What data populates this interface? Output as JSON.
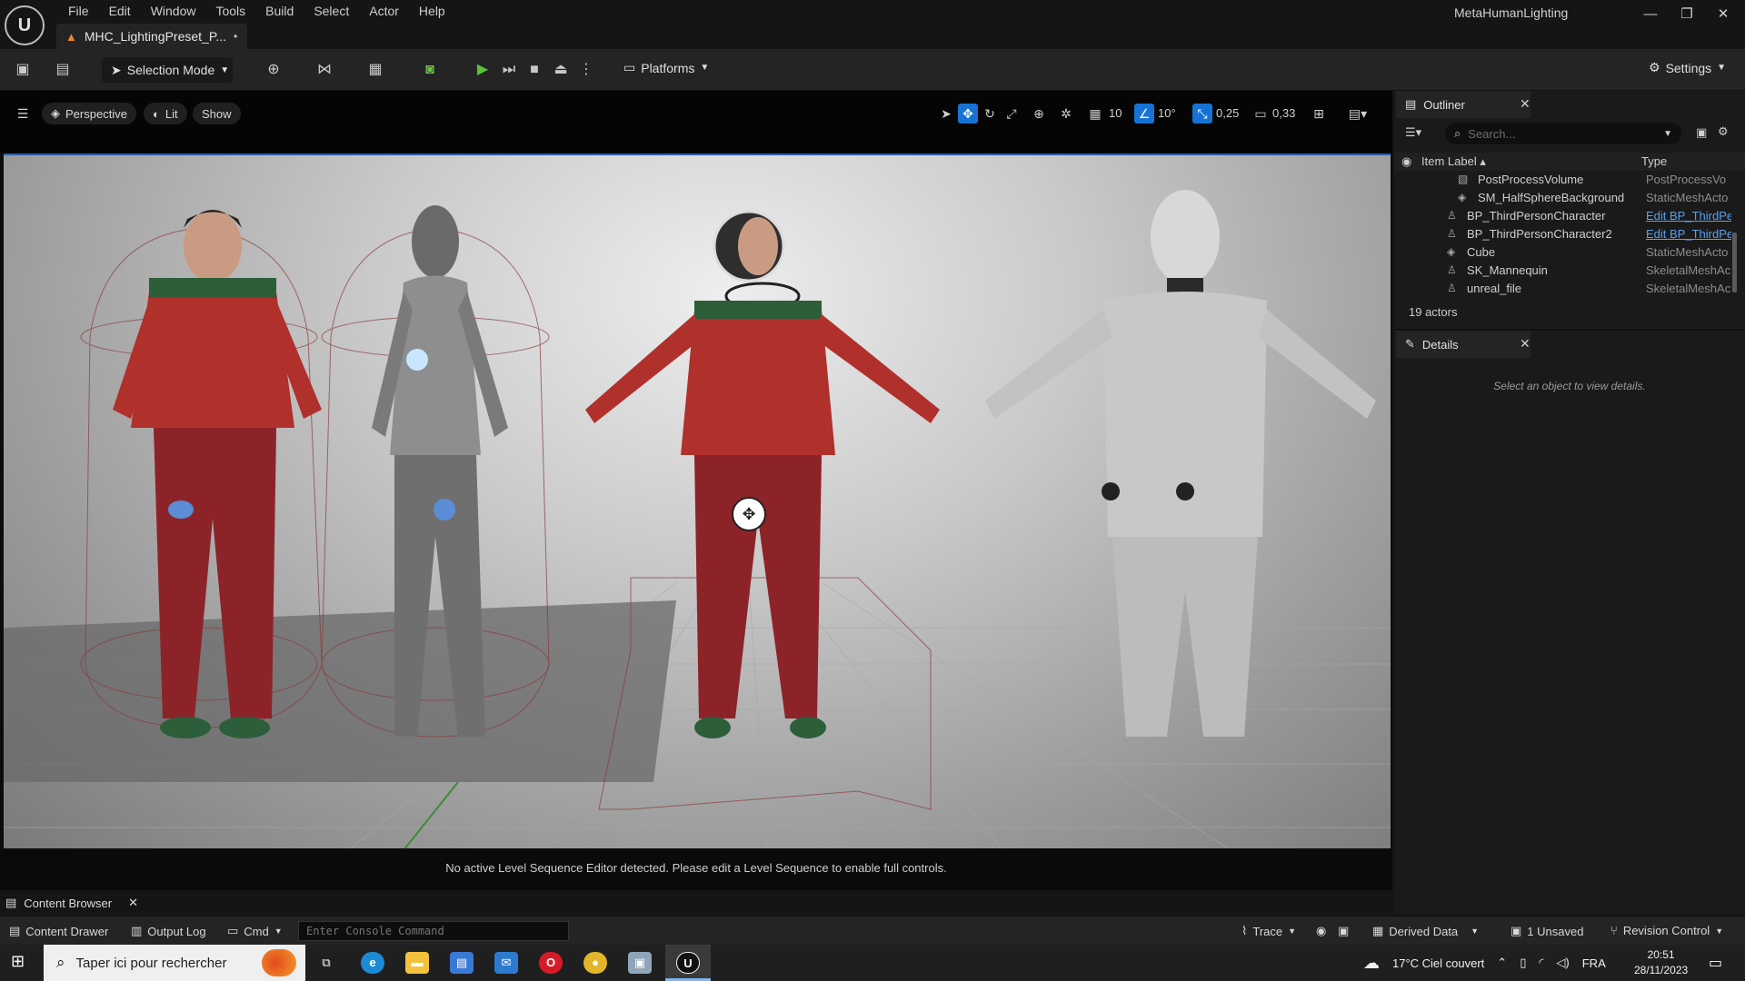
{
  "window": {
    "project_name": "MetaHumanLighting",
    "document_tab": "MHC_LightingPreset_P...",
    "dirty_marker": "•",
    "min": "—",
    "restore": "❐",
    "close": "✕"
  },
  "menu": [
    "File",
    "Edit",
    "Window",
    "Tools",
    "Build",
    "Select",
    "Actor",
    "Help"
  ],
  "toolbar": {
    "selection_mode": "Selection Mode",
    "platforms": "Platforms",
    "settings": "Settings"
  },
  "viewport": {
    "perspective": "Perspective",
    "lit": "Lit",
    "show": "Show",
    "grid_size": "10",
    "rotation_snap": "10°",
    "scale_snap": "0,25",
    "camera_speed": "0,33",
    "sequence_message": "No active Level Sequence Editor detected. Please edit a Level Sequence to enable full controls."
  },
  "outliner": {
    "tab": "Outliner",
    "search_placeholder": "Search...",
    "col_label": "Item Label ▴",
    "col_type": "Type",
    "rows": [
      {
        "label": "PostProcessVolume",
        "type": "PostProcessVo",
        "link": false
      },
      {
        "label": "SM_HalfSphereBackground",
        "type": "StaticMeshActo",
        "link": false
      },
      {
        "label": "BP_ThirdPersonCharacter",
        "type": "Edit BP_ThirdPe",
        "link": true
      },
      {
        "label": "BP_ThirdPersonCharacter2",
        "type": "Edit BP_ThirdPe",
        "link": true
      },
      {
        "label": "Cube",
        "type": "StaticMeshActo",
        "link": false
      },
      {
        "label": "SK_Mannequin",
        "type": "SkeletalMeshAc",
        "link": false
      },
      {
        "label": "unreal_file",
        "type": "SkeletalMeshAc",
        "link": false
      }
    ],
    "count": "19 actors"
  },
  "details": {
    "tab": "Details",
    "message": "Select an object to view details."
  },
  "bottom": {
    "content_browser_tab": "Content Browser",
    "content_drawer": "Content Drawer",
    "output_log": "Output Log",
    "cmd": "Cmd",
    "console_placeholder": "Enter Console Command",
    "trace": "Trace",
    "derived_data": "Derived Data",
    "unsaved": "1 Unsaved",
    "revision_control": "Revision Control"
  },
  "taskbar": {
    "search_placeholder": "Taper ici pour rechercher",
    "weather": "17°C  Ciel couvert",
    "language": "FRA",
    "time": "20:51",
    "date": "28/11/2023"
  },
  "colors": {
    "accent": "#1673d6",
    "play": "#5bc236",
    "link": "#5aa0f2",
    "sweater_red": "#b0302c",
    "sweater_green": "#2c5e3a",
    "pants": "#8c2328"
  }
}
